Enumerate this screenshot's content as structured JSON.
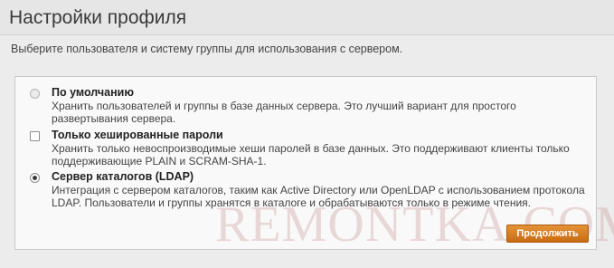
{
  "header": {
    "title": "Настройки профиля"
  },
  "subtitle": "Выберите пользователя и систему группы для использования с сервером.",
  "options": [
    {
      "label": "По умолчанию",
      "description": "Хранить пользователей и группы в базе данных сервера. Это лучший вариант для простого развертывания сервера.",
      "control": "radio",
      "checked": false,
      "disabled": true
    },
    {
      "label": "Только хешированные пароли",
      "description": "Хранить только невоспроизводимые хеши паролей в базе данных. Это поддерживают клиенты только поддерживающие PLAIN и SCRAM-SHA-1.",
      "control": "checkbox",
      "checked": false
    },
    {
      "label": "Сервер каталогов (LDAP)",
      "description": "Интеграция с сервером каталогов, таким как Active Directory или OpenLDAP с использованием протокола LDAP. Пользователи и группы хранятся в каталоге и обрабатываются только в режиме чтения.",
      "control": "radio",
      "checked": true
    }
  ],
  "continue_label": "Продолжить",
  "watermark": "REMONTKA.COM",
  "colors": {
    "button": "#d97b1e",
    "background": "#ececec",
    "panel": "#f9f9f9"
  }
}
